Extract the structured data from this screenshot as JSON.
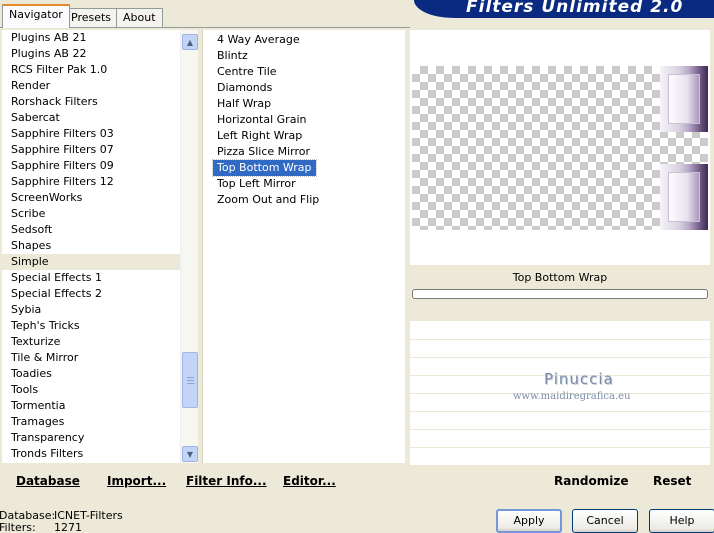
{
  "tabs": [
    {
      "label": "Navigator",
      "active": true
    },
    {
      "label": "Presets",
      "active": false
    },
    {
      "label": "About",
      "active": false
    }
  ],
  "banner_title": "Filters Unlimited 2.0",
  "categories": [
    "Plugins AB 21",
    "Plugins AB 22",
    "RCS Filter Pak 1.0",
    "Render",
    "Rorshack Filters",
    "Sabercat",
    "Sapphire Filters 03",
    "Sapphire Filters 07",
    "Sapphire Filters 09",
    "Sapphire Filters 12",
    "ScreenWorks",
    "Scribe",
    "Sedsoft",
    "Shapes",
    "Simple",
    "Special Effects 1",
    "Special Effects 2",
    "Sybia",
    "Teph's Tricks",
    "Texturize",
    "Tile & Mirror",
    "Toadies",
    "Tools",
    "Tormentia",
    "Tramages",
    "Transparency",
    "Tronds Filters"
  ],
  "highlighted_category": "Simple",
  "filters": [
    "4 Way Average",
    "Blintz",
    "Centre Tile",
    "Diamonds",
    "Half Wrap",
    "Horizontal Grain",
    "Left Right Wrap",
    "Pizza Slice Mirror",
    "Top Bottom Wrap",
    "Top Left Mirror",
    "Zoom Out and Flip"
  ],
  "selected_filter": "Top Bottom Wrap",
  "preview": {
    "filter_name": "Top Bottom Wrap",
    "watermark_name": "Pinuccia",
    "watermark_url": "www.maidiregrafica.eu"
  },
  "actions": {
    "database": "Database",
    "import": "Import...",
    "filter_info": "Filter Info...",
    "editor": "Editor...",
    "randomize": "Randomize",
    "reset": "Reset"
  },
  "status": {
    "database_label": "Database:",
    "database_value": "ICNET-Filters",
    "filters_label": "Filters:",
    "filters_value": "1271"
  },
  "buttons": {
    "apply": "Apply",
    "cancel": "Cancel",
    "help": "Help"
  },
  "scroll_icons": {
    "up": "▲",
    "down": "▼"
  }
}
